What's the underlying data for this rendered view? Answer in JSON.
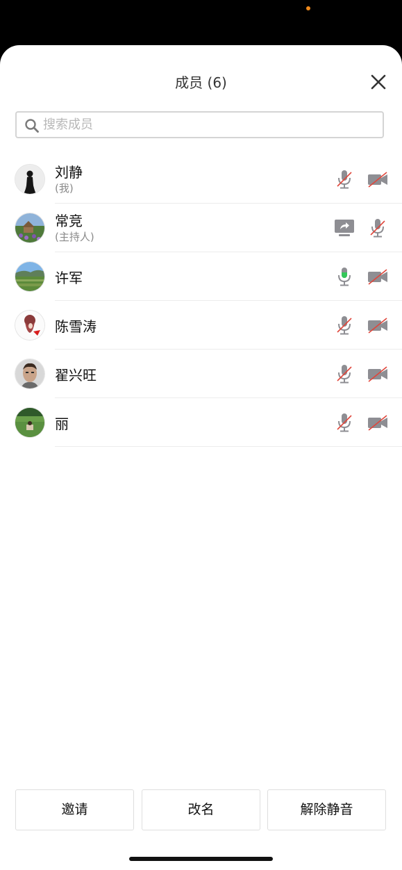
{
  "header": {
    "title": "成员 (6)"
  },
  "search": {
    "placeholder": "搜索成员",
    "value": ""
  },
  "members": [
    {
      "name": "刘静",
      "role": "(我)",
      "mic": "muted",
      "camera": "off",
      "screen_share": false
    },
    {
      "name": "常竞",
      "role": "(主持人)",
      "mic": "muted",
      "camera": "none",
      "screen_share": true
    },
    {
      "name": "许军",
      "role": "",
      "mic": "active",
      "camera": "off",
      "screen_share": false
    },
    {
      "name": "陈雪涛",
      "role": "",
      "mic": "muted",
      "camera": "off",
      "screen_share": false
    },
    {
      "name": "翟兴旺",
      "role": "",
      "mic": "muted",
      "camera": "off",
      "screen_share": false
    },
    {
      "name": "丽",
      "role": "",
      "mic": "muted",
      "camera": "off",
      "screen_share": false
    }
  ],
  "actions": {
    "invite_label": "邀请",
    "rename_label": "改名",
    "unmute_label": "解除静音"
  },
  "icons": {
    "close": "close-icon",
    "search": "search-icon",
    "mic_muted": "mic-muted-icon",
    "mic_active": "mic-icon",
    "camera_off": "camera-off-icon",
    "screen_share": "screen-share-icon"
  },
  "colors": {
    "accent_dot": "#f08a1c",
    "mute_slash": "#e0463b",
    "mic_active": "#34c759",
    "icon_gray": "#8e8e93"
  }
}
